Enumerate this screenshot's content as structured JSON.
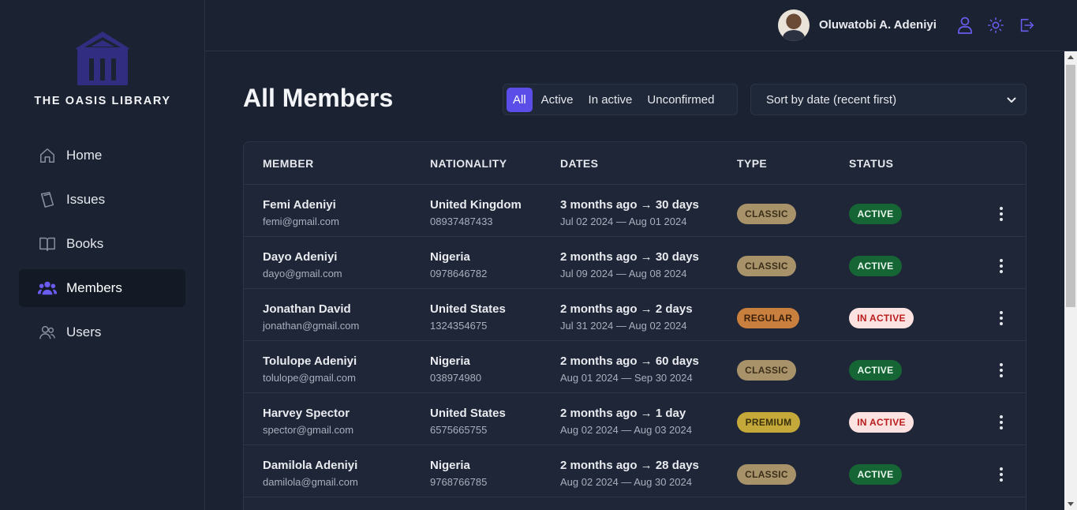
{
  "app": {
    "logo_text": "THE OASIS LIBRARY"
  },
  "sidebar": {
    "items": [
      {
        "label": "Home",
        "icon": "home-icon",
        "active": false
      },
      {
        "label": "Issues",
        "icon": "book-stack-icon",
        "active": false
      },
      {
        "label": "Books",
        "icon": "open-book-icon",
        "active": false
      },
      {
        "label": "Members",
        "icon": "group-icon",
        "active": true
      },
      {
        "label": "Users",
        "icon": "users-icon",
        "active": false
      }
    ]
  },
  "header": {
    "user_name": "Oluwatobi A. Adeniyi",
    "icons": [
      "user-icon",
      "sun-icon",
      "logout-icon"
    ]
  },
  "main": {
    "title": "All Members",
    "filters": [
      "All",
      "Active",
      "In active",
      "Unconfirmed"
    ],
    "active_filter": "All",
    "sort_selected": "Sort by date (recent first)",
    "columns": [
      "MEMBER",
      "NATIONALITY",
      "DATES",
      "TYPE",
      "STATUS"
    ],
    "rows": [
      {
        "name": "Femi Adeniyi",
        "email": "femi@gmail.com",
        "country": "United Kingdom",
        "phone": "08937487433",
        "duration": "3 months ago → 30 days",
        "range": "Jul 02 2024 — Aug 01 2024",
        "type": "CLASSIC",
        "status": "ACTIVE"
      },
      {
        "name": "Dayo Adeniyi",
        "email": "dayo@gmail.com",
        "country": "Nigeria",
        "phone": "0978646782",
        "duration": "2 months ago → 30 days",
        "range": "Jul 09 2024 — Aug 08 2024",
        "type": "CLASSIC",
        "status": "ACTIVE"
      },
      {
        "name": "Jonathan David",
        "email": "jonathan@gmail.com",
        "country": "United States",
        "phone": "1324354675",
        "duration": "2 months ago → 2 days",
        "range": "Jul 31 2024 — Aug 02 2024",
        "type": "REGULAR",
        "status": "IN ACTIVE"
      },
      {
        "name": "Tolulope Adeniyi",
        "email": "tolulope@gmail.com",
        "country": "Nigeria",
        "phone": "038974980",
        "duration": "2 months ago → 60 days",
        "range": "Aug 01 2024 — Sep 30 2024",
        "type": "CLASSIC",
        "status": "ACTIVE"
      },
      {
        "name": "Harvey Spector",
        "email": "spector@gmail.com",
        "country": "United States",
        "phone": "6575665755",
        "duration": "2 months ago → 1 day",
        "range": "Aug 02 2024 — Aug 03 2024",
        "type": "PREMIUM",
        "status": "IN ACTIVE"
      },
      {
        "name": "Damilola Adeniyi",
        "email": "damilola@gmail.com",
        "country": "Nigeria",
        "phone": "9768766785",
        "duration": "2 months ago → 28 days",
        "range": "Aug 02 2024 — Aug 30 2024",
        "type": "CLASSIC",
        "status": "ACTIVE"
      }
    ]
  },
  "colors": {
    "accent": "#5b4de8",
    "logo": "#312e81",
    "type_classic_bg": "#a8926a",
    "type_regular_bg": "#c9803f",
    "type_premium_bg": "#c4a93a",
    "status_active_bg": "#166534",
    "status_inactive_bg": "#fde2e2",
    "status_inactive_text": "#b91c1c"
  }
}
